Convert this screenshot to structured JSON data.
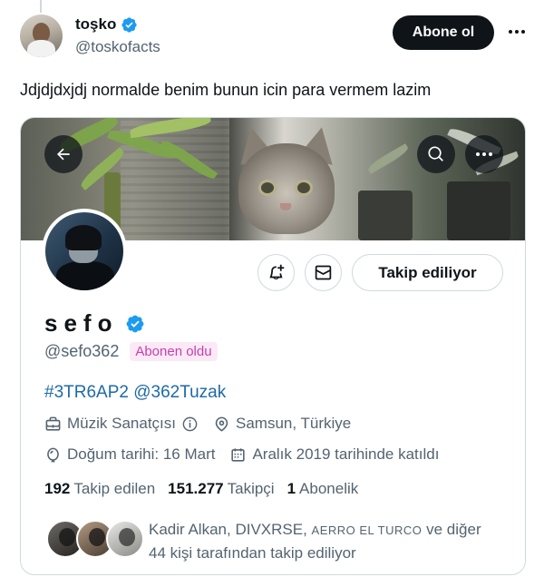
{
  "author": {
    "name": "toşko",
    "handle": "@toskofacts",
    "subscribe_label": "Abone ol"
  },
  "tweet": {
    "text": "Jdjdjdxjdj normalde benim bunun icin para vermem lazim"
  },
  "profile": {
    "name": "sefo",
    "handle": "@sefo362",
    "subscribed_badge": "Abonen oldu",
    "follow_label": "Takip ediliyor",
    "bio": "#3TR6AP2 @362Tuzak",
    "category": "Müzik Sanatçısı",
    "location": "Samsun, Türkiye",
    "birthday": "Doğum tarihi: 16 Mart",
    "joined": "Aralık 2019 tarihinde katıldı",
    "stats": {
      "following_count": "192",
      "following_label": "Takip edilen",
      "followers_count": "151.277",
      "followers_label": "Takipçi",
      "subscriptions_count": "1",
      "subscriptions_label": "Abonelik"
    },
    "followed_by": {
      "names": "Kadir Alkan, DIVXRSE,",
      "name_smallcaps": "AERRO EL TURCO",
      "suffix": " ve diğer",
      "line2": "44 kişi tarafından takip ediliyor"
    }
  },
  "icons": {
    "verified": "verified-badge-icon",
    "more": "more-dots-icon",
    "back": "back-arrow-icon",
    "search": "search-icon",
    "notify": "bell-plus-icon",
    "message": "envelope-icon",
    "category": "briefcase-icon",
    "info": "info-icon",
    "location": "location-pin-icon",
    "birthday": "balloon-icon",
    "calendar": "calendar-icon"
  },
  "colors": {
    "verified_blue": "#1d9bf0",
    "subscribe_bg": "#0f1419",
    "badge_text": "#c93db0",
    "badge_bg": "#fbeaf6",
    "link": "#1d6aa8",
    "secondary_text": "#536471"
  }
}
